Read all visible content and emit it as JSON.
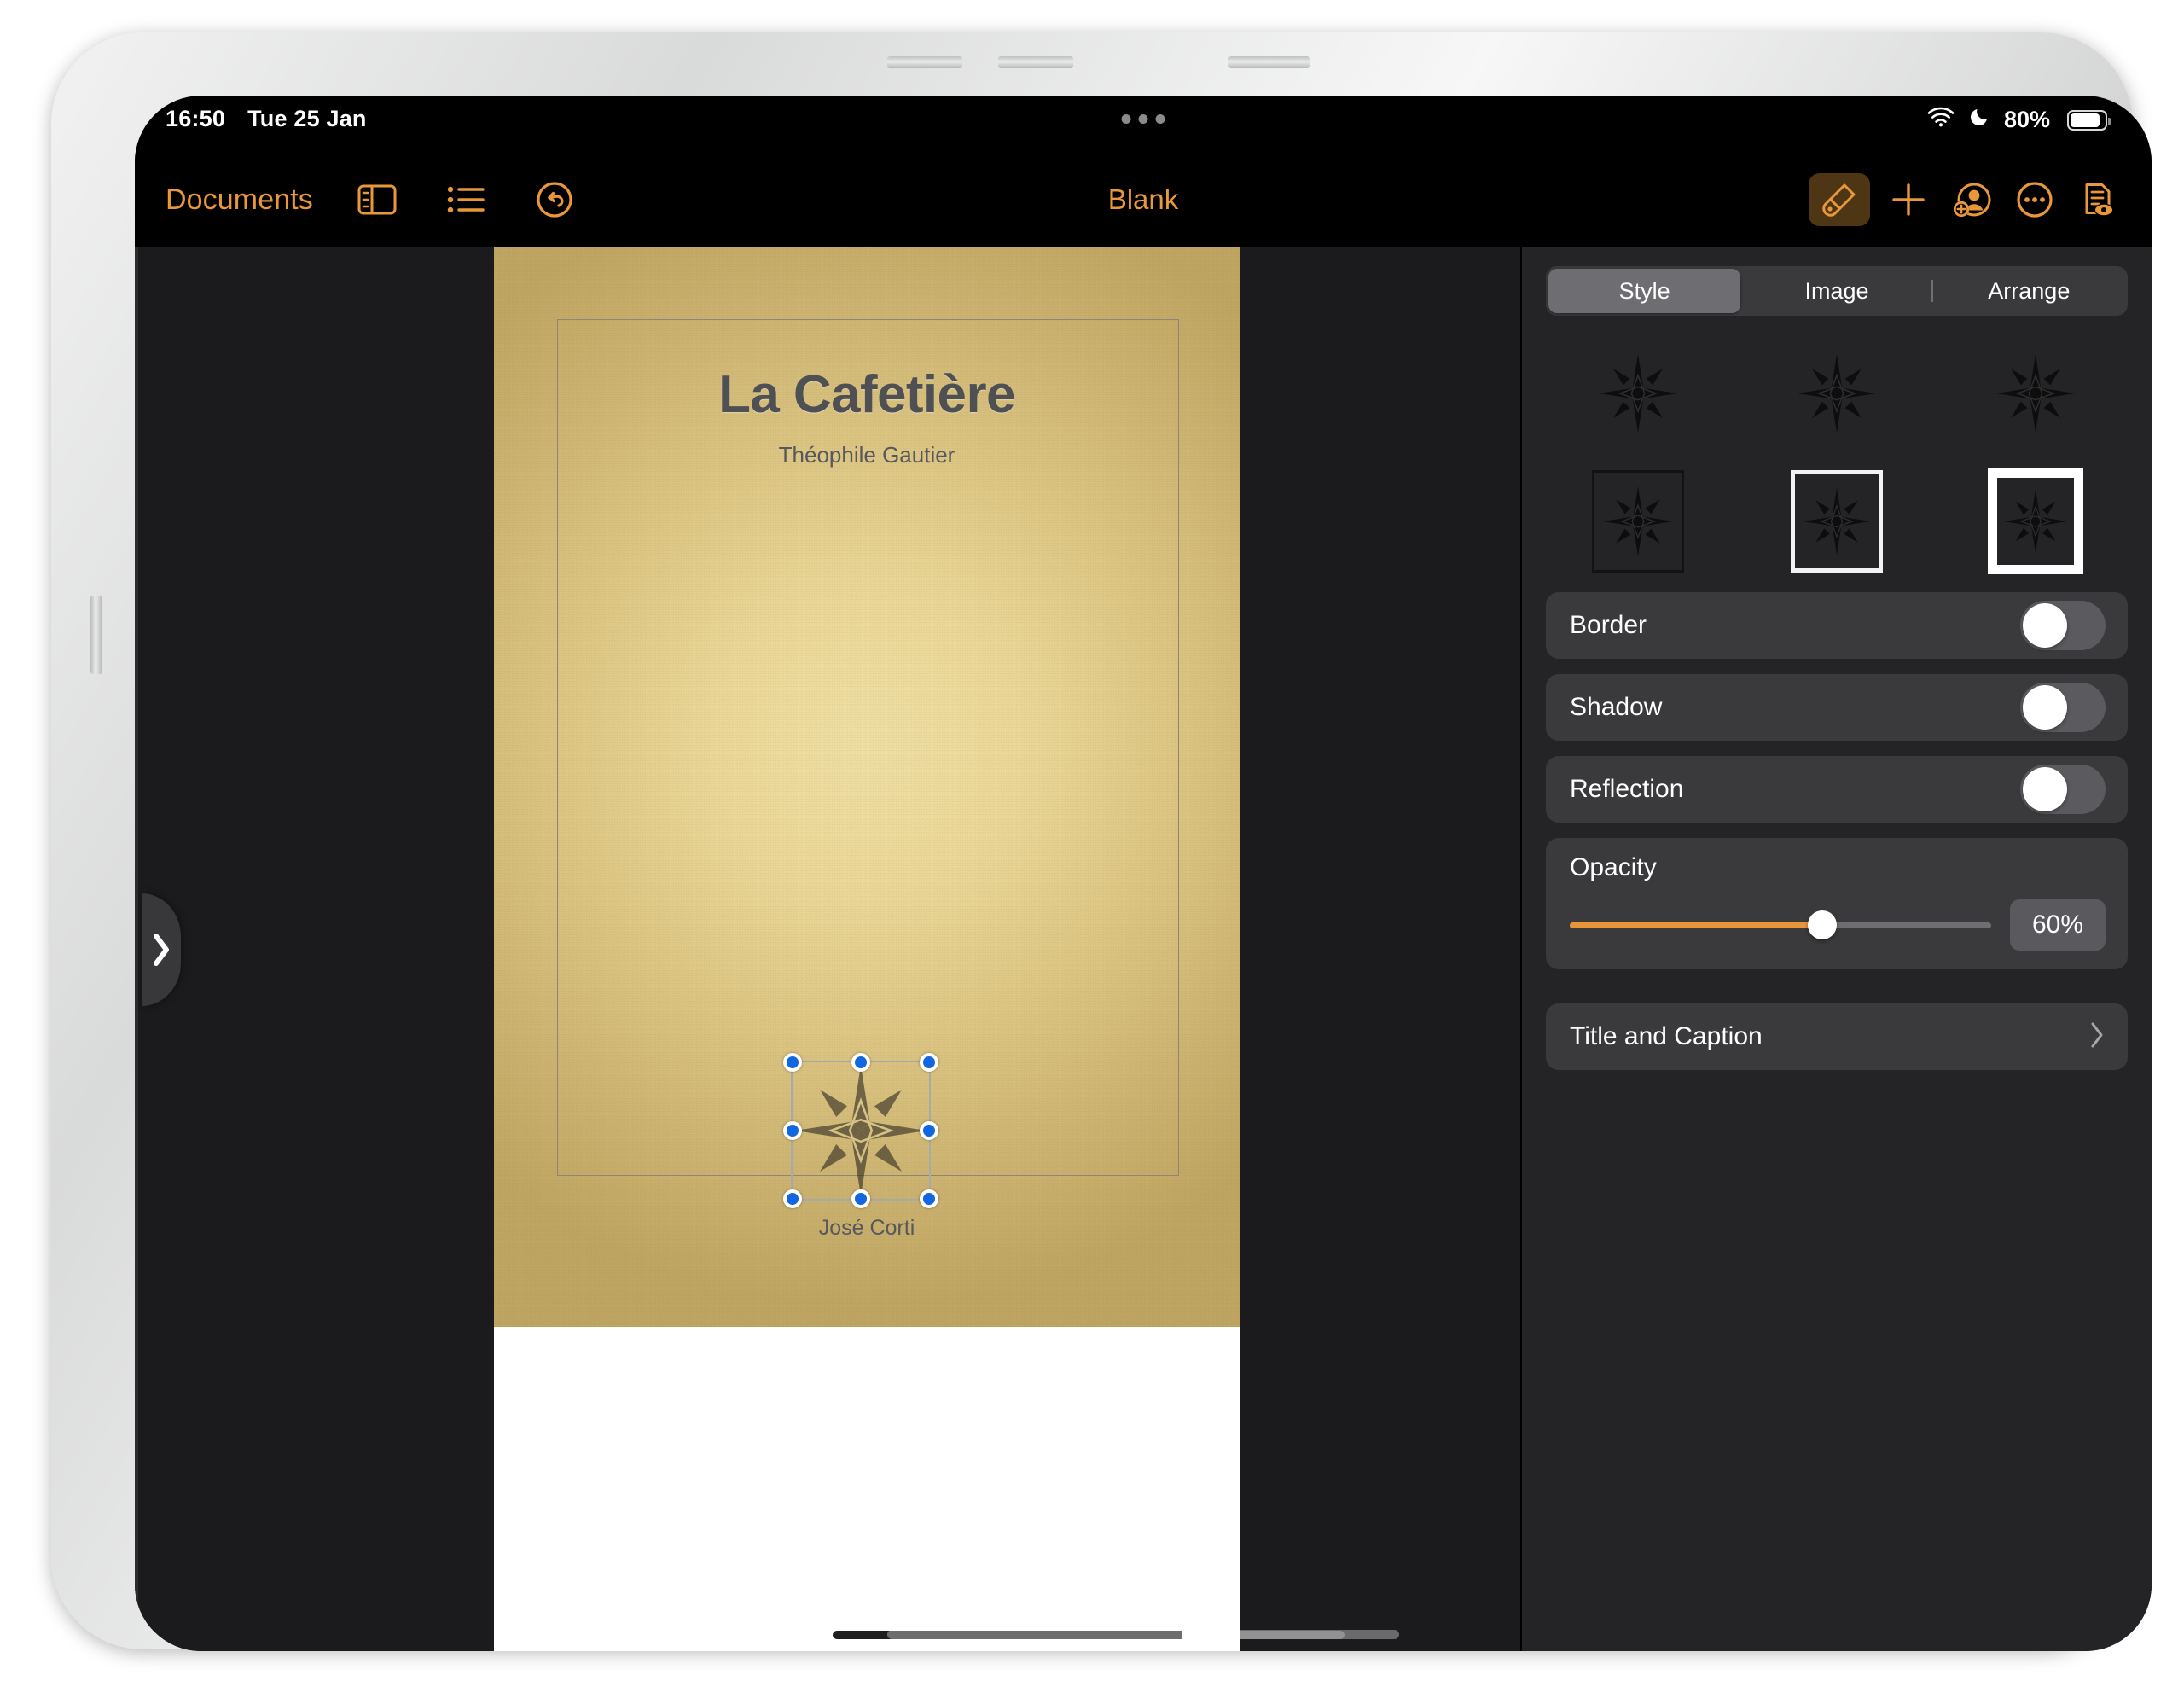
{
  "status_bar": {
    "time": "16:50",
    "date": "Tue 25 Jan",
    "battery_percent": "80%",
    "battery_level_pct": 80,
    "wifi_icon": "wifi-icon",
    "dnd_icon": "moon-crescent-icon",
    "battery_icon": "battery-icon"
  },
  "toolbar": {
    "documents_label": "Documents",
    "doc_title": "Blank",
    "sidebar_icon": "sidebar-toggle-icon",
    "list_icon": "bulleted-list-icon",
    "undo_icon": "undo-icon",
    "format_icon": "paintbrush-icon",
    "insert_icon": "plus-icon",
    "collaborate_icon": "add-person-icon",
    "more_icon": "ellipsis-circle-icon",
    "view_icon": "document-eye-icon"
  },
  "canvas": {
    "sidebar_reveal_icon": "chevron-right-icon",
    "page": {
      "title": "La Cafetière",
      "author": "Théophile Gautier",
      "image_caption": "José Corti",
      "image_name": "compass-rose-image",
      "image_opacity": 0.6
    }
  },
  "panel": {
    "segments": [
      {
        "label": "Style",
        "selected": true
      },
      {
        "label": "Image",
        "selected": false
      },
      {
        "label": "Arrange",
        "selected": false
      }
    ],
    "presets": [
      {
        "name": "style-preset-1",
        "frame": "none",
        "selected": false
      },
      {
        "name": "style-preset-2",
        "frame": "none",
        "selected": false
      },
      {
        "name": "style-preset-3",
        "frame": "none",
        "selected": false
      },
      {
        "name": "style-preset-4",
        "frame": "thin-dark",
        "selected": false
      },
      {
        "name": "style-preset-5",
        "frame": "thin-white",
        "selected": false
      },
      {
        "name": "style-preset-6",
        "frame": "thick-white",
        "selected": true
      }
    ],
    "toggles": [
      {
        "label": "Border",
        "on": false
      },
      {
        "label": "Shadow",
        "on": false
      },
      {
        "label": "Reflection",
        "on": false
      }
    ],
    "opacity": {
      "label": "Opacity",
      "value_label": "60%",
      "value_pct": 60
    },
    "title_and_caption": {
      "label": "Title and Caption",
      "chevron_icon": "chevron-right-icon"
    }
  },
  "colors": {
    "accent_orange": "#e8973a",
    "panel_bg": "#242426",
    "row_bg": "#3a3a3c",
    "selection_blue": "#1266e0",
    "page_gold": "#ecd999"
  }
}
